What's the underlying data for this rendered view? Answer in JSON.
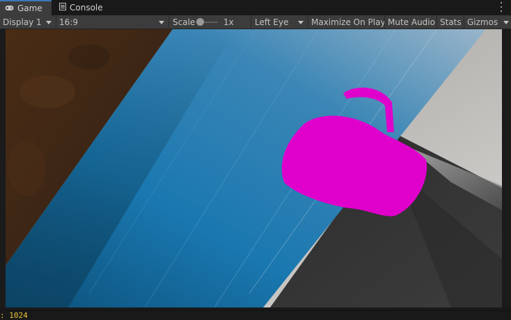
{
  "tabs": {
    "game": {
      "label": "Game",
      "icon": "gamepad-icon"
    },
    "console": {
      "label": "Console",
      "icon": "console-icon"
    }
  },
  "toolbar": {
    "display": "Display 1",
    "aspect": "16:9",
    "scale_label": "Scale",
    "scale_value": "1x",
    "scale_level": 0.1,
    "eye": "Left Eye",
    "maximize": "Maximize On Play",
    "mute": "Mute Audio",
    "stats": "Stats",
    "gizmos": "Gizmos"
  },
  "status": {
    "text": ": 1024"
  },
  "colors": {
    "accent": "#3a79bb",
    "toolbar_bg": "#3c3c3c",
    "status_text": "#e8c33a",
    "missing_material": "#e000cc"
  }
}
